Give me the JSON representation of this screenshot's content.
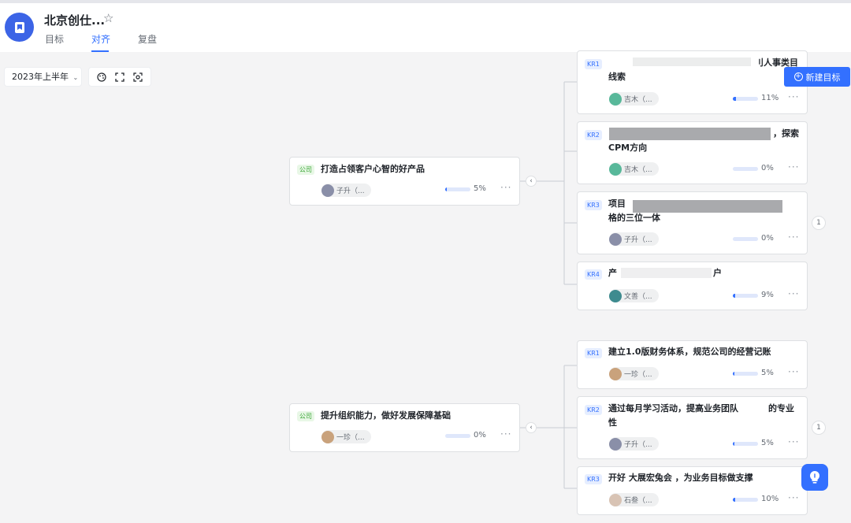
{
  "header": {
    "title": "北京创仕...",
    "tabs": [
      {
        "label": "目标",
        "active": false
      },
      {
        "label": "对齐",
        "active": true
      },
      {
        "label": "复盘",
        "active": false
      }
    ]
  },
  "toolbar": {
    "period": "2023年上半年",
    "new_goal": "新建目标"
  },
  "objectives": [
    {
      "badge": "公司",
      "title": "打造占领客户心智的好产品",
      "owner": "子升（...",
      "progress": 5,
      "progress_label": "5%",
      "krs": [
        {
          "badge": "KR1",
          "title_line1": "刂人事类目",
          "title_line2": "线索",
          "owner": "吉木（...",
          "progress": 11,
          "progress_label": "11%"
        },
        {
          "badge": "KR2",
          "title_line1": "，探索",
          "title_line2": "CPM方向",
          "owner": "吉木（...",
          "progress": 0,
          "progress_label": "0%"
        },
        {
          "badge": "KR3",
          "title_line1": "项目",
          "title_line2": "格的三位一体",
          "owner": "子升（...",
          "progress": 0,
          "progress_label": "0%"
        },
        {
          "badge": "KR4",
          "title_line1": "产",
          "title_line1b": "户",
          "owner": "文善（...",
          "progress": 9,
          "progress_label": "9%"
        }
      ],
      "count": "1"
    },
    {
      "badge": "公司",
      "title": "提升组织能力，做好发展保障基础",
      "owner": "一珍（...",
      "progress": 0,
      "progress_label": "0%",
      "krs": [
        {
          "badge": "KR1",
          "title_line1": "建立1.0版财务体系，规范公司的经营记账",
          "owner": "一珍（...",
          "progress": 5,
          "progress_label": "5%"
        },
        {
          "badge": "KR2",
          "title_line1": "通过每月学习活动，提高业务团队",
          "title_line1b": "的专业",
          "title_line2": "性",
          "owner": "子升（...",
          "progress": 5,
          "progress_label": "5%"
        },
        {
          "badge": "KR3",
          "title_line1": "开好 大展宏兔会 ，为业务目标做支撑",
          "owner": "石叁（...",
          "progress": 10,
          "progress_label": "10%"
        }
      ],
      "count": "1"
    }
  ],
  "colors": {
    "accent": "#3370ff",
    "company_badge": "#3aa635",
    "logo": "#3c64e6"
  },
  "icons": [
    "bookmark-icon",
    "star-icon",
    "chevron-down-icon",
    "palette-icon",
    "fullscreen-icon",
    "focus-icon",
    "plus-circle-icon",
    "chevron-left-icon",
    "more-icon",
    "lightbulb-icon"
  ]
}
